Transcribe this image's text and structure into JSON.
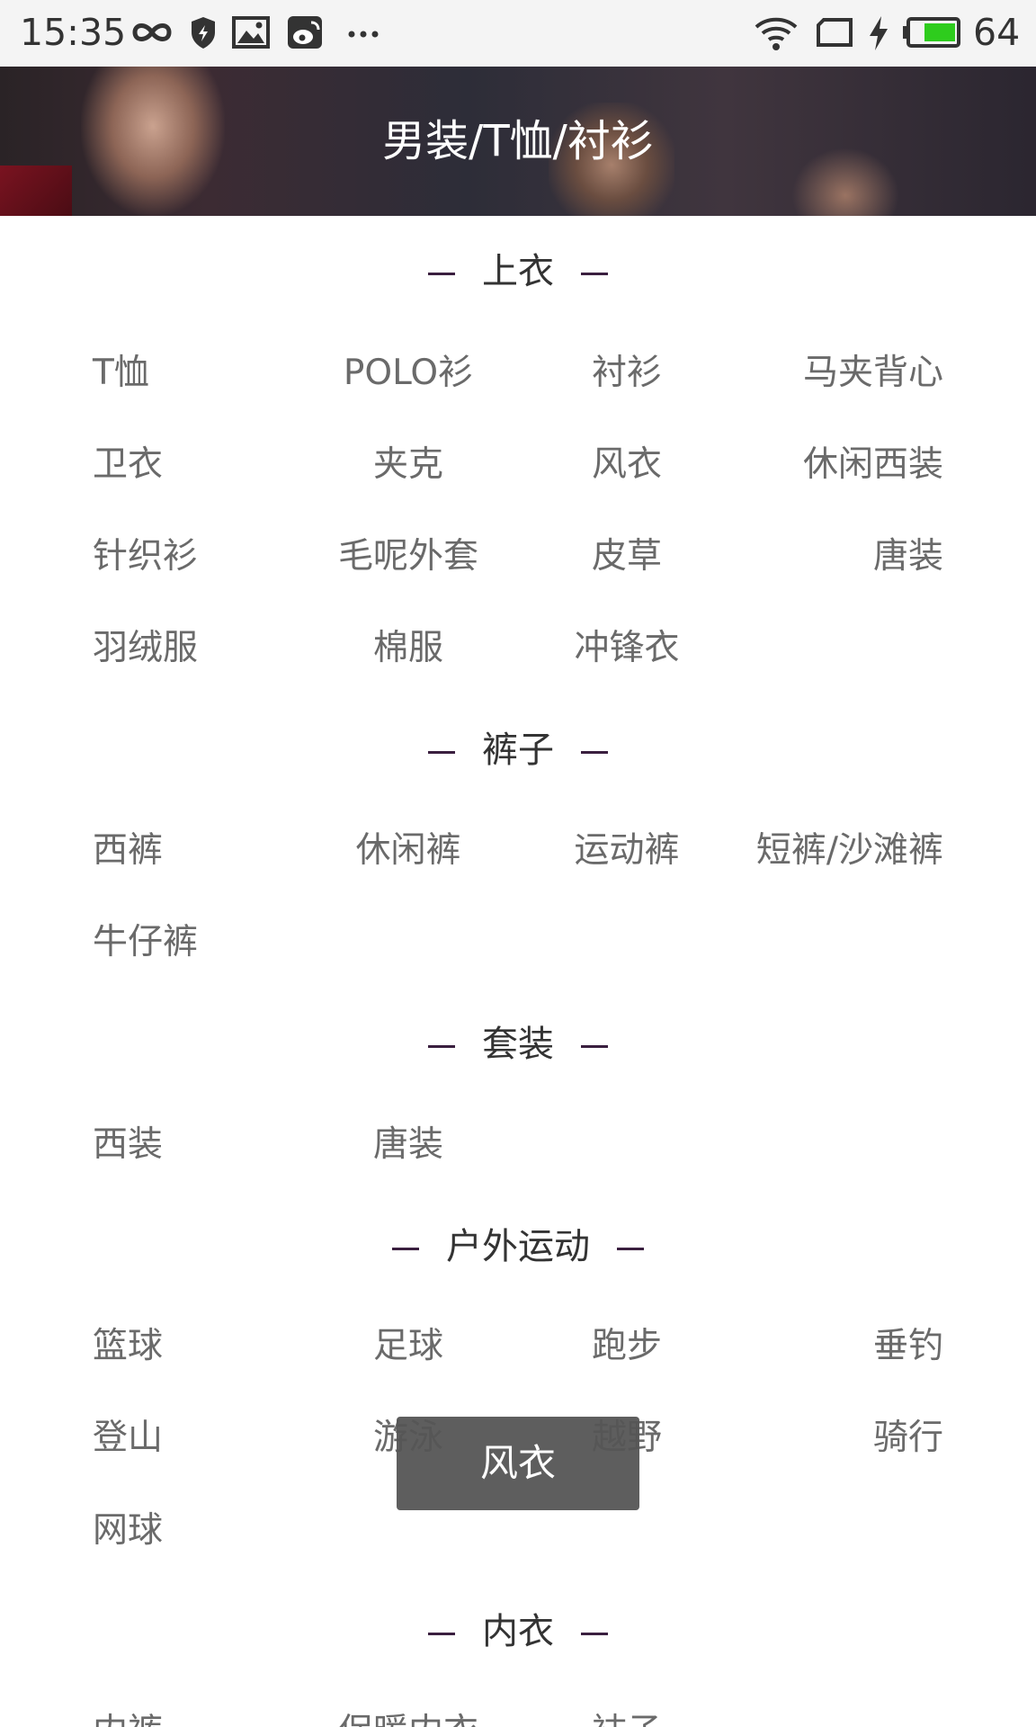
{
  "status_bar": {
    "time": "15:35",
    "battery": "64",
    "icons": [
      "infinity-icon",
      "shield-icon",
      "image-icon",
      "weibo-icon",
      "more-dots-icon",
      "wifi-icon",
      "screen-rotate-icon",
      "charging-bolt-icon",
      "battery-icon"
    ],
    "battery_color": "#2ecc1d"
  },
  "banner": {
    "title": "男装/T恤/衬衫"
  },
  "sections": [
    {
      "title": "上衣",
      "items": [
        "T恤",
        "POLO衫",
        "衬衫",
        "马夹背心",
        "卫衣",
        "夹克",
        "风衣",
        "休闲西装",
        "针织衫",
        "毛呢外套",
        "皮草",
        "唐装",
        "羽绒服",
        "棉服",
        "冲锋衣"
      ]
    },
    {
      "title": "裤子",
      "items": [
        "西裤",
        "休闲裤",
        "运动裤",
        "短裤/沙滩裤",
        "牛仔裤"
      ]
    },
    {
      "title": "套装",
      "items": [
        "西装",
        "唐装"
      ]
    },
    {
      "title": "户外运动",
      "items": [
        "篮球",
        "足球",
        "跑步",
        "垂钓",
        "登山",
        "游泳",
        "越野",
        "骑行",
        "网球"
      ]
    },
    {
      "title": "内衣",
      "items": [
        "内裤",
        "保暖内衣",
        "袜子"
      ]
    }
  ],
  "toast": {
    "text": "风衣"
  }
}
